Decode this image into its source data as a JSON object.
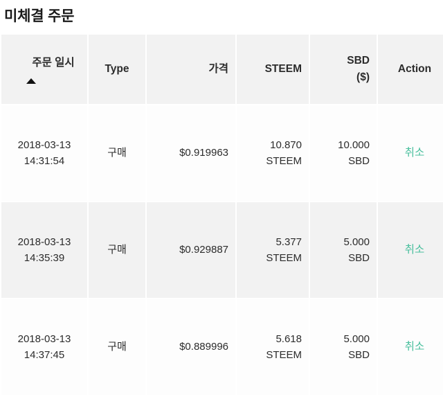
{
  "page": {
    "title": "미체결 주문"
  },
  "table": {
    "columns": [
      {
        "key": "date",
        "label": "주문 일시",
        "sort_icon": "sort-ascending-icon"
      },
      {
        "key": "type",
        "label": "Type"
      },
      {
        "key": "price",
        "label": "가격"
      },
      {
        "key": "steem",
        "label": "STEEM"
      },
      {
        "key": "sbd",
        "label": "SBD ($)",
        "label_line1": "SBD",
        "label_line2": "($)"
      },
      {
        "key": "action",
        "label": "Action"
      }
    ],
    "rows": [
      {
        "date": "2018-03-13 14:31:54",
        "type": "구매",
        "price": "$0.919963",
        "steem_amount": "10.870",
        "steem_unit": "STEEM",
        "sbd_amount": "10.000",
        "sbd_unit": "SBD",
        "action_label": "취소"
      },
      {
        "date": "2018-03-13 14:35:39",
        "type": "구매",
        "price": "$0.929887",
        "steem_amount": "5.377",
        "steem_unit": "STEEM",
        "sbd_amount": "5.000",
        "sbd_unit": "SBD",
        "action_label": "취소"
      },
      {
        "date": "2018-03-13 14:37:45",
        "type": "구매",
        "price": "$0.889996",
        "steem_amount": "5.618",
        "steem_unit": "STEEM",
        "sbd_amount": "5.000",
        "sbd_unit": "SBD",
        "action_label": "취소"
      }
    ]
  },
  "colors": {
    "accent_green": "#49bf9d",
    "header_bg": "#f2f2f2",
    "row_alt_bg": "#f2f2f2",
    "text": "#2b2b2b",
    "page_bg": "#ffffff"
  }
}
